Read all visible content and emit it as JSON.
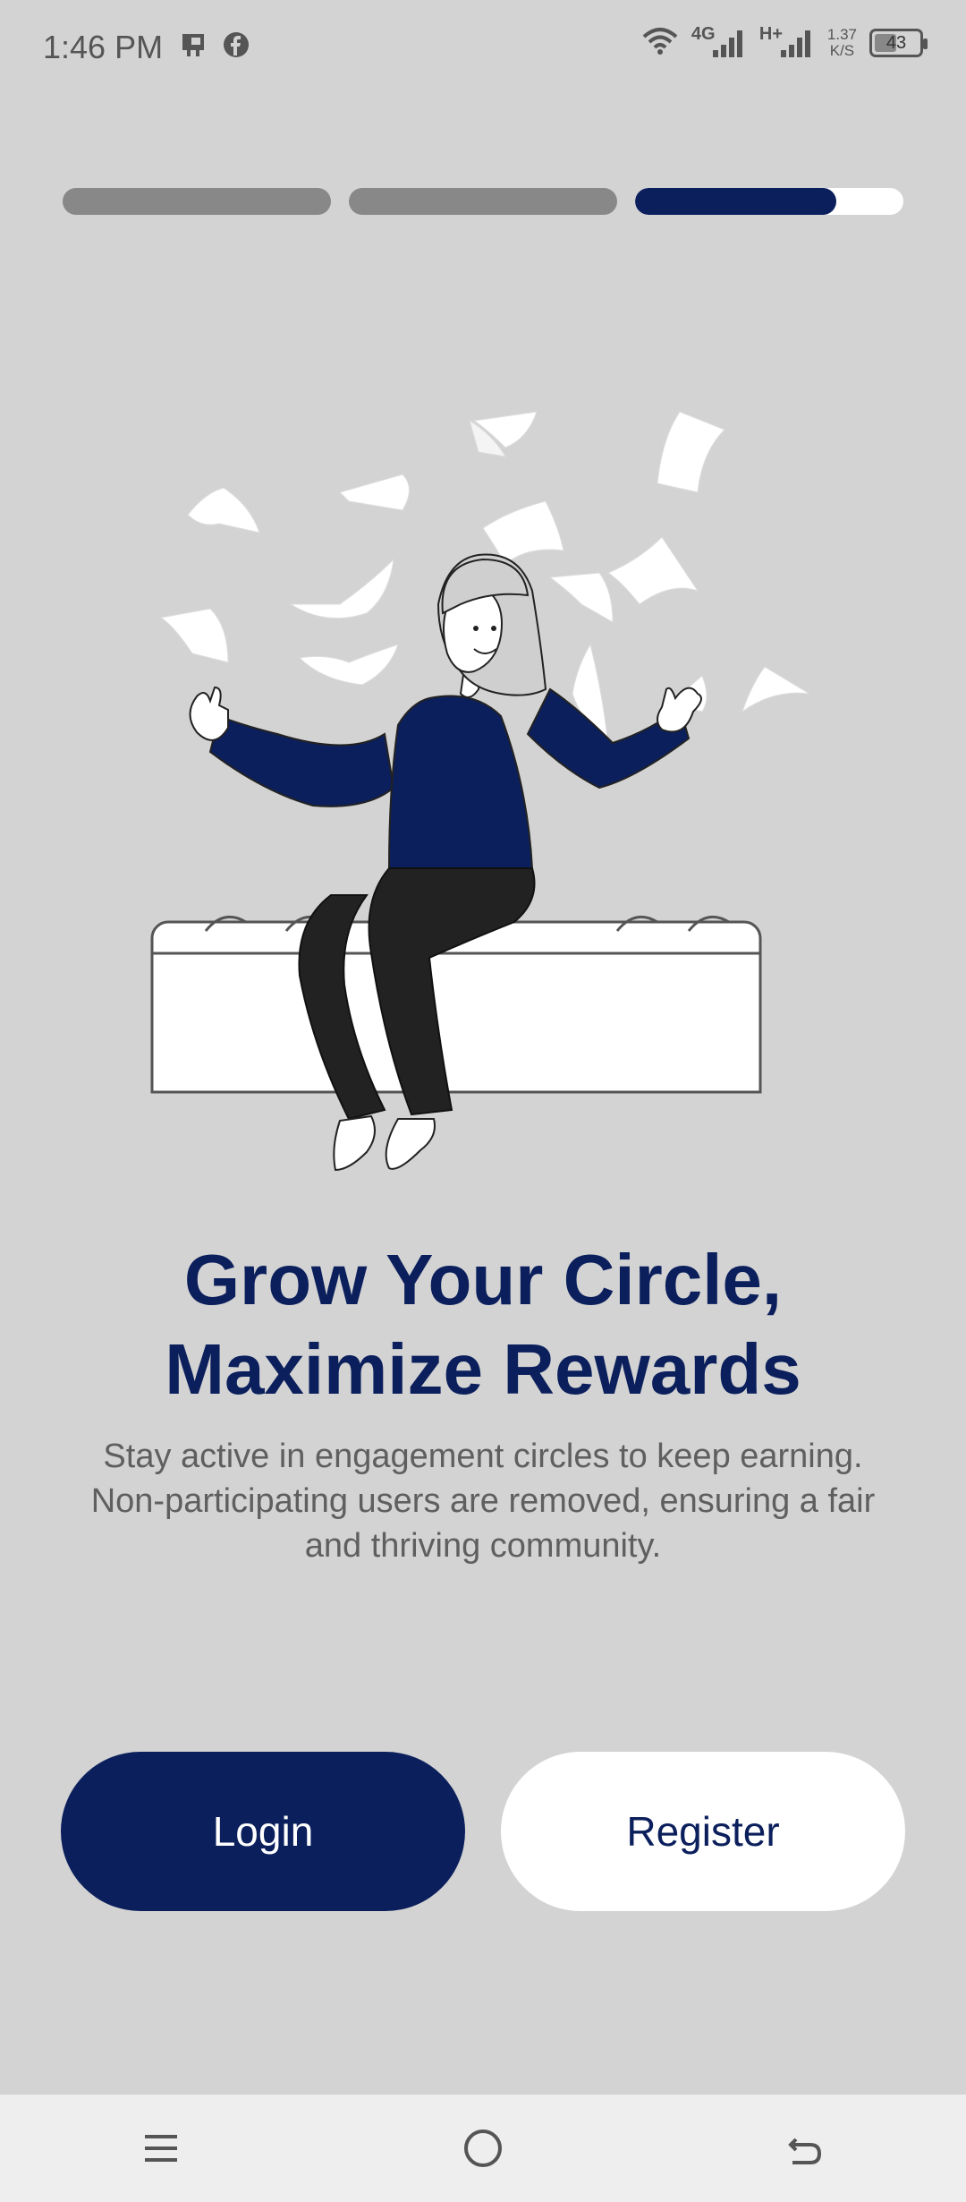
{
  "status_bar": {
    "time": "1:46 PM",
    "network_1": "4G",
    "network_2": "H+",
    "speed_value": "1.37",
    "speed_unit": "K/S",
    "battery": "43",
    "icons": [
      "phone-card-icon",
      "facebook-icon",
      "wifi-icon",
      "signal-icon",
      "signal-icon",
      "battery-icon"
    ]
  },
  "onboarding": {
    "total_steps": 3,
    "current_step": 3,
    "current_step_progress": 0.75
  },
  "content": {
    "title_line1": "Grow Your Circle,",
    "title_line2": "Maximize Rewards",
    "description": "Stay active in engagement circles to keep earning. Non-participating users are removed, ensuring a fair and thriving community."
  },
  "actions": {
    "login_label": "Login",
    "register_label": "Register"
  },
  "nav": {
    "icons": [
      "menu-icon",
      "home-icon",
      "back-icon"
    ]
  },
  "colors": {
    "primary": "#0b1f5c",
    "background": "#d3d3d3",
    "inactive_segment": "#888888",
    "white": "#ffffff"
  }
}
